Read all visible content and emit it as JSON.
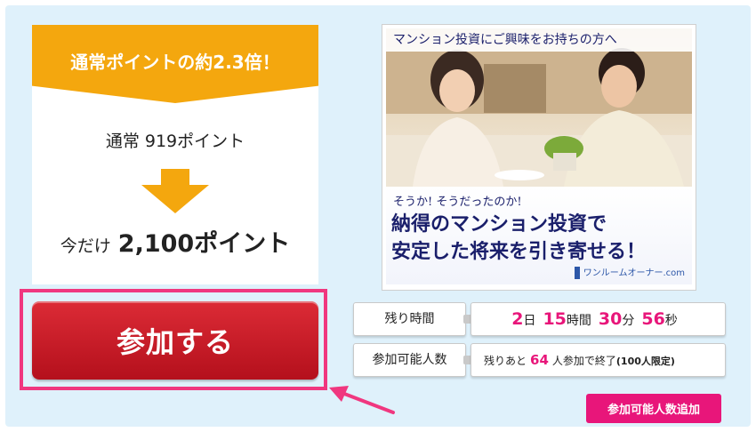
{
  "promo": {
    "headline": "通常ポイントの約2.3倍！",
    "normal_label": "通常 919ポイント",
    "now_label": "今だけ",
    "now_points": "2,100ポイント"
  },
  "join_button": "参加する",
  "ad": {
    "top_text": "マンション投資にご興味をお持ちの方へ",
    "line1": "そうか! そうだったのか!",
    "line2": "納得のマンション投資で",
    "line3": "安定した将来を引き寄せる！",
    "brand": "ワンルームオーナー.com"
  },
  "timer": {
    "label": "残り時間",
    "days": "2",
    "days_unit": "日",
    "hours": "15",
    "hours_unit": "時間",
    "minutes": "30",
    "minutes_unit": "分",
    "seconds": "56",
    "seconds_unit": "秒"
  },
  "capacity": {
    "label": "参加可能人数",
    "prefix": "残りあと",
    "remaining": "64",
    "suffix": "人参加で終了",
    "limit": "(100人限定)"
  },
  "add_button": "参加可能人数追加",
  "colors": {
    "panel_bg": "#dff1fb",
    "banner_orange": "#f4a70e",
    "join_red": "#c81a27",
    "accent_pink": "#e8167a"
  }
}
